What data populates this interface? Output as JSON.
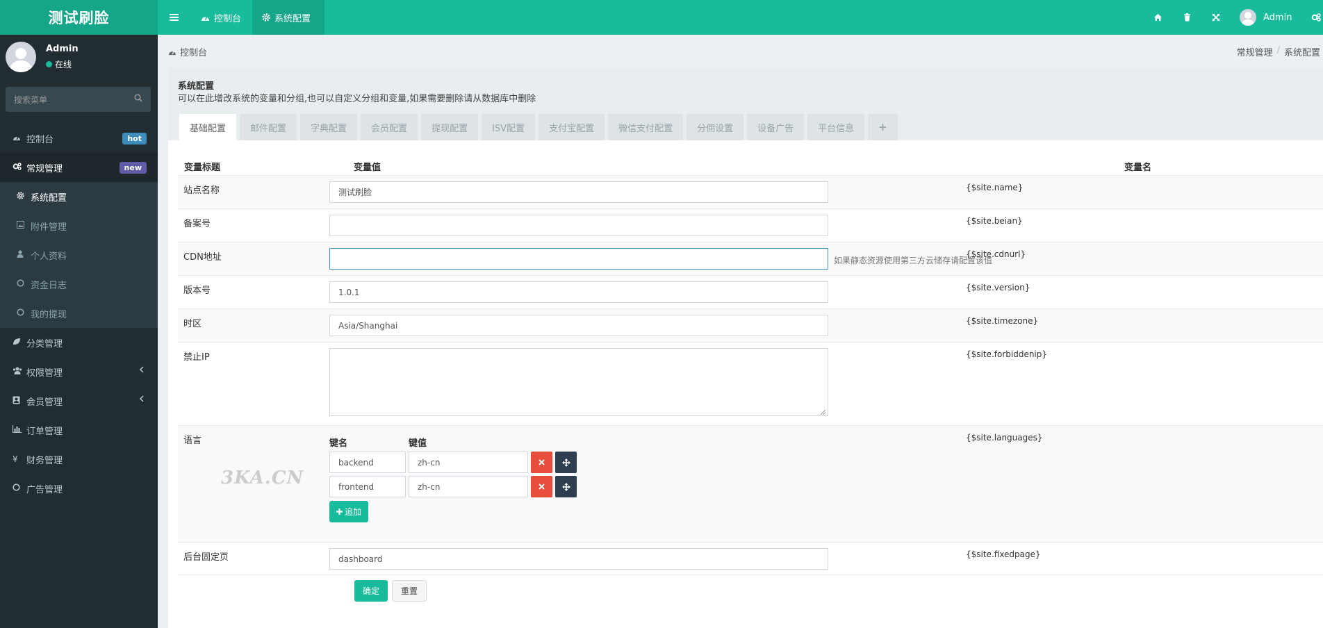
{
  "header": {
    "logo": "测试刷脸",
    "tabs": [
      {
        "label": "控制台",
        "icon": "dashboard-icon"
      },
      {
        "label": "系统配置",
        "icon": "gear-icon"
      }
    ],
    "right_icons": [
      "home-icon",
      "trash-icon",
      "fullscreen-icon"
    ],
    "user": "Admin"
  },
  "sidebar": {
    "user": {
      "name": "Admin",
      "status": "在线"
    },
    "search_placeholder": "搜索菜单",
    "items": [
      {
        "label": "控制台",
        "icon": "dashboard-icon",
        "badge": "hot",
        "badge_color": "#3c8dbc"
      },
      {
        "label": "常规管理",
        "icon": "cogs-icon",
        "badge": "new",
        "badge_color": "#605ca8"
      },
      {
        "label": "系统配置",
        "icon": "gear-icon"
      },
      {
        "label": "附件管理",
        "icon": "image-icon"
      },
      {
        "label": "个人资料",
        "icon": "user-icon"
      },
      {
        "label": "资金日志",
        "icon": "circle-icon"
      },
      {
        "label": "我的提现",
        "icon": "circle-icon"
      },
      {
        "label": "分类管理",
        "icon": "leaf-icon"
      },
      {
        "label": "权限管理",
        "icon": "group-icon"
      },
      {
        "label": "会员管理",
        "icon": "user-card-icon"
      },
      {
        "label": "订单管理",
        "icon": "bar-chart-icon"
      },
      {
        "label": "财务管理",
        "icon": "yen-icon"
      },
      {
        "label": "广告管理",
        "icon": "circle-icon"
      }
    ]
  },
  "breadcrumb": {
    "left": "控制台",
    "right": [
      "常规管理",
      "系统配置"
    ]
  },
  "panel": {
    "title": "系统配置",
    "description": "可以在此增改系统的变量和分组,也可以自定义分组和变量,如果需要删除请从数据库中删除",
    "tabs": [
      "基础配置",
      "邮件配置",
      "字典配置",
      "会员配置",
      "提现配置",
      "ISV配置",
      "支付宝配置",
      "微信支付配置",
      "分佣设置",
      "设备广告",
      "平台信息",
      "+"
    ]
  },
  "table": {
    "headers": {
      "title": "变量标题",
      "value": "变量值",
      "name": "变量名"
    },
    "rows": [
      {
        "label": "站点名称",
        "value": "测试刷脸",
        "var": "{$site.name}"
      },
      {
        "label": "备案号",
        "value": "",
        "var": "{$site.beian}"
      },
      {
        "label": "CDN地址",
        "value": "",
        "var": "{$site.cdnurl}",
        "hint": "如果静态资源使用第三方云储存请配置该值"
      },
      {
        "label": "版本号",
        "value": "1.0.1",
        "var": "{$site.version}"
      },
      {
        "label": "时区",
        "value": "Asia/Shanghai",
        "var": "{$site.timezone}"
      },
      {
        "label": "禁止IP",
        "value": "",
        "var": "{$site.forbiddenip}"
      },
      {
        "label": "语言",
        "var": "{$site.languages}",
        "key_header": "键名",
        "val_header": "键值",
        "pairs": [
          {
            "key": "backend",
            "val": "zh-cn"
          },
          {
            "key": "frontend",
            "val": "zh-cn"
          }
        ],
        "add_label": "追加"
      },
      {
        "label": "后台固定页",
        "value": "dashboard",
        "var": "{$site.fixedpage}"
      }
    ]
  },
  "watermark": "3KA.CN",
  "buttons": {
    "submit": "确定",
    "reset": "重置"
  }
}
